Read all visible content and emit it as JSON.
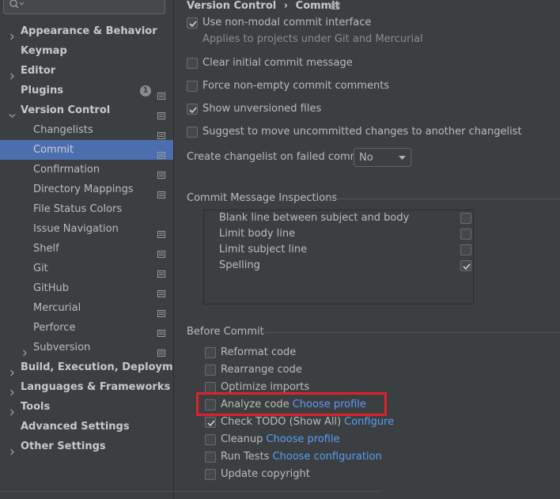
{
  "search": {
    "placeholder": ""
  },
  "sidebar": {
    "items": [
      {
        "label": "Appearance & Behavior",
        "expandable": true,
        "expanded": false,
        "bold": true,
        "indent": 0
      },
      {
        "label": "Keymap",
        "expandable": false,
        "bold": true,
        "indent": 0
      },
      {
        "label": "Editor",
        "expandable": true,
        "expanded": false,
        "bold": true,
        "indent": 0
      },
      {
        "label": "Plugins",
        "expandable": false,
        "bold": true,
        "indent": 0,
        "badge": "1",
        "project_icon": true
      },
      {
        "label": "Version Control",
        "expandable": true,
        "expanded": true,
        "bold": true,
        "indent": 0,
        "project_icon": true
      },
      {
        "label": "Changelists",
        "indent": 1,
        "project_icon": true
      },
      {
        "label": "Commit",
        "indent": 1,
        "selected": true,
        "project_icon": true
      },
      {
        "label": "Confirmation",
        "indent": 1,
        "project_icon": true
      },
      {
        "label": "Directory Mappings",
        "indent": 1,
        "project_icon": true
      },
      {
        "label": "File Status Colors",
        "indent": 1
      },
      {
        "label": "Issue Navigation",
        "indent": 1,
        "project_icon": true
      },
      {
        "label": "Shelf",
        "indent": 1,
        "project_icon": true
      },
      {
        "label": "Git",
        "indent": 1,
        "project_icon": true
      },
      {
        "label": "GitHub",
        "indent": 1,
        "project_icon": true
      },
      {
        "label": "Mercurial",
        "indent": 1,
        "project_icon": true
      },
      {
        "label": "Perforce",
        "indent": 1,
        "project_icon": true
      },
      {
        "label": "Subversion",
        "indent": 1,
        "expandable": true,
        "expanded": false,
        "project_icon": true
      },
      {
        "label": "Build, Execution, Deployment",
        "expandable": true,
        "expanded": false,
        "bold": true,
        "indent": 0
      },
      {
        "label": "Languages & Frameworks",
        "expandable": true,
        "expanded": false,
        "bold": true,
        "indent": 0
      },
      {
        "label": "Tools",
        "expandable": true,
        "expanded": false,
        "bold": true,
        "indent": 0
      },
      {
        "label": "Advanced Settings",
        "expandable": false,
        "bold": true,
        "indent": 0
      },
      {
        "label": "Other Settings",
        "expandable": true,
        "expanded": false,
        "bold": true,
        "indent": 0
      }
    ]
  },
  "breadcrumb": {
    "parent": "Version Control",
    "separator": "›",
    "current": "Commit"
  },
  "options": {
    "non_modal": {
      "label": "Use non-modal commit interface",
      "checked": true,
      "hint": "Applies to projects under Git and Mercurial"
    },
    "clear_initial": {
      "label": "Clear initial commit message",
      "checked": false
    },
    "force_non_empty": {
      "label": "Force non-empty commit comments",
      "checked": false
    },
    "show_unversioned": {
      "label": "Show unversioned files",
      "checked": true
    },
    "suggest_move": {
      "label": "Suggest to move uncommitted changes to another changelist",
      "checked": false
    },
    "create_changelist": {
      "label": "Create changelist on failed commit:",
      "value": "No"
    }
  },
  "inspections": {
    "title": "Commit Message Inspections",
    "items": [
      {
        "label": "Blank line between subject and body",
        "checked": false
      },
      {
        "label": "Limit body line",
        "checked": false
      },
      {
        "label": "Limit subject line",
        "checked": false
      },
      {
        "label": "Spelling",
        "checked": true
      }
    ]
  },
  "before_commit": {
    "title": "Before Commit",
    "items": [
      {
        "label": "Reformat code",
        "checked": false,
        "link": ""
      },
      {
        "label": "Rearrange code",
        "checked": false,
        "link": ""
      },
      {
        "label": "Optimize imports",
        "checked": false,
        "link": ""
      },
      {
        "label": "Analyze code",
        "checked": false,
        "link": "Choose profile",
        "highlighted": true
      },
      {
        "label": "Check TODO (Show All)",
        "checked": true,
        "link": "Configure"
      },
      {
        "label": "Cleanup",
        "checked": false,
        "link": "Choose profile"
      },
      {
        "label": "Run Tests",
        "checked": false,
        "link": "Choose configuration"
      },
      {
        "label": "Update copyright",
        "checked": false,
        "link": ""
      }
    ]
  },
  "colors": {
    "selection": "#4b6eaf",
    "link": "#589df6",
    "highlight_box": "#e0202a",
    "background": "#3c3f41"
  }
}
